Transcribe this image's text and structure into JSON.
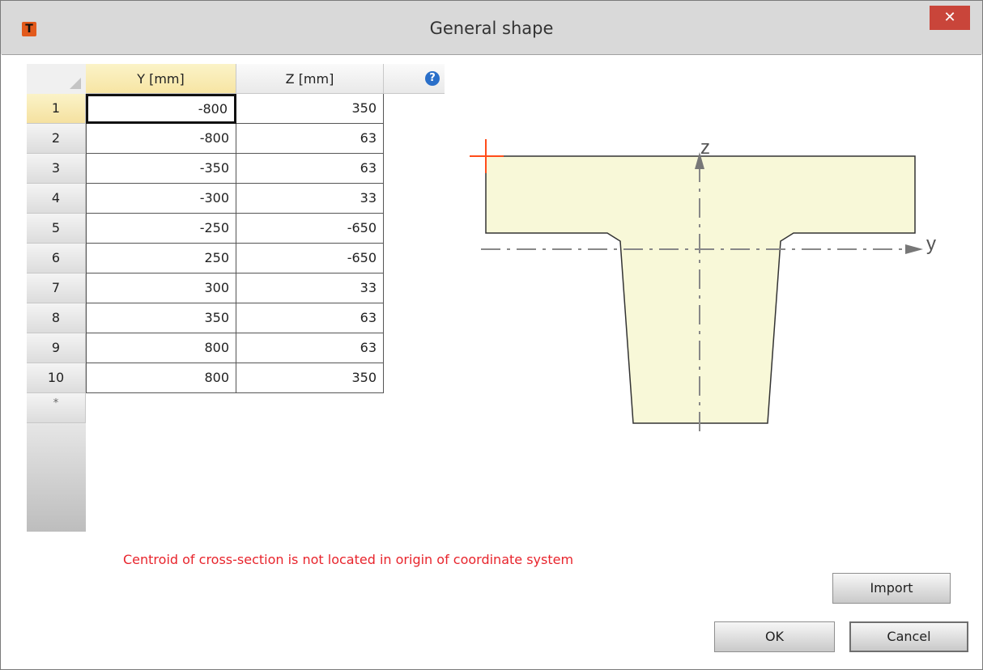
{
  "window": {
    "title": "General shape",
    "app_icon_glyph": "T",
    "close_glyph": "✕"
  },
  "grid": {
    "columns": [
      "Y [mm]",
      "Z [mm]"
    ],
    "help_glyph": "?",
    "rows": [
      {
        "index": "1",
        "y": "-800",
        "z": "350"
      },
      {
        "index": "2",
        "y": "-800",
        "z": "63"
      },
      {
        "index": "3",
        "y": "-350",
        "z": "63"
      },
      {
        "index": "4",
        "y": "-300",
        "z": "33"
      },
      {
        "index": "5",
        "y": "-250",
        "z": "-650"
      },
      {
        "index": "6",
        "y": "250",
        "z": "-650"
      },
      {
        "index": "7",
        "y": "300",
        "z": "33"
      },
      {
        "index": "8",
        "y": "350",
        "z": "63"
      },
      {
        "index": "9",
        "y": "800",
        "z": "63"
      },
      {
        "index": "10",
        "y": "800",
        "z": "350"
      }
    ],
    "new_row_marker": "*"
  },
  "drawing": {
    "axis_y_label": "y",
    "axis_z_label": "z",
    "fill_color": "#f8f8d8",
    "outline_color": "#333333",
    "origin_marker_color": "#ff4c1a"
  },
  "message": {
    "warning": "Centroid of cross-section is not located in origin of coordinate system",
    "color": "#e8242c"
  },
  "buttons": {
    "import": "Import",
    "ok": "OK",
    "cancel": "Cancel"
  }
}
